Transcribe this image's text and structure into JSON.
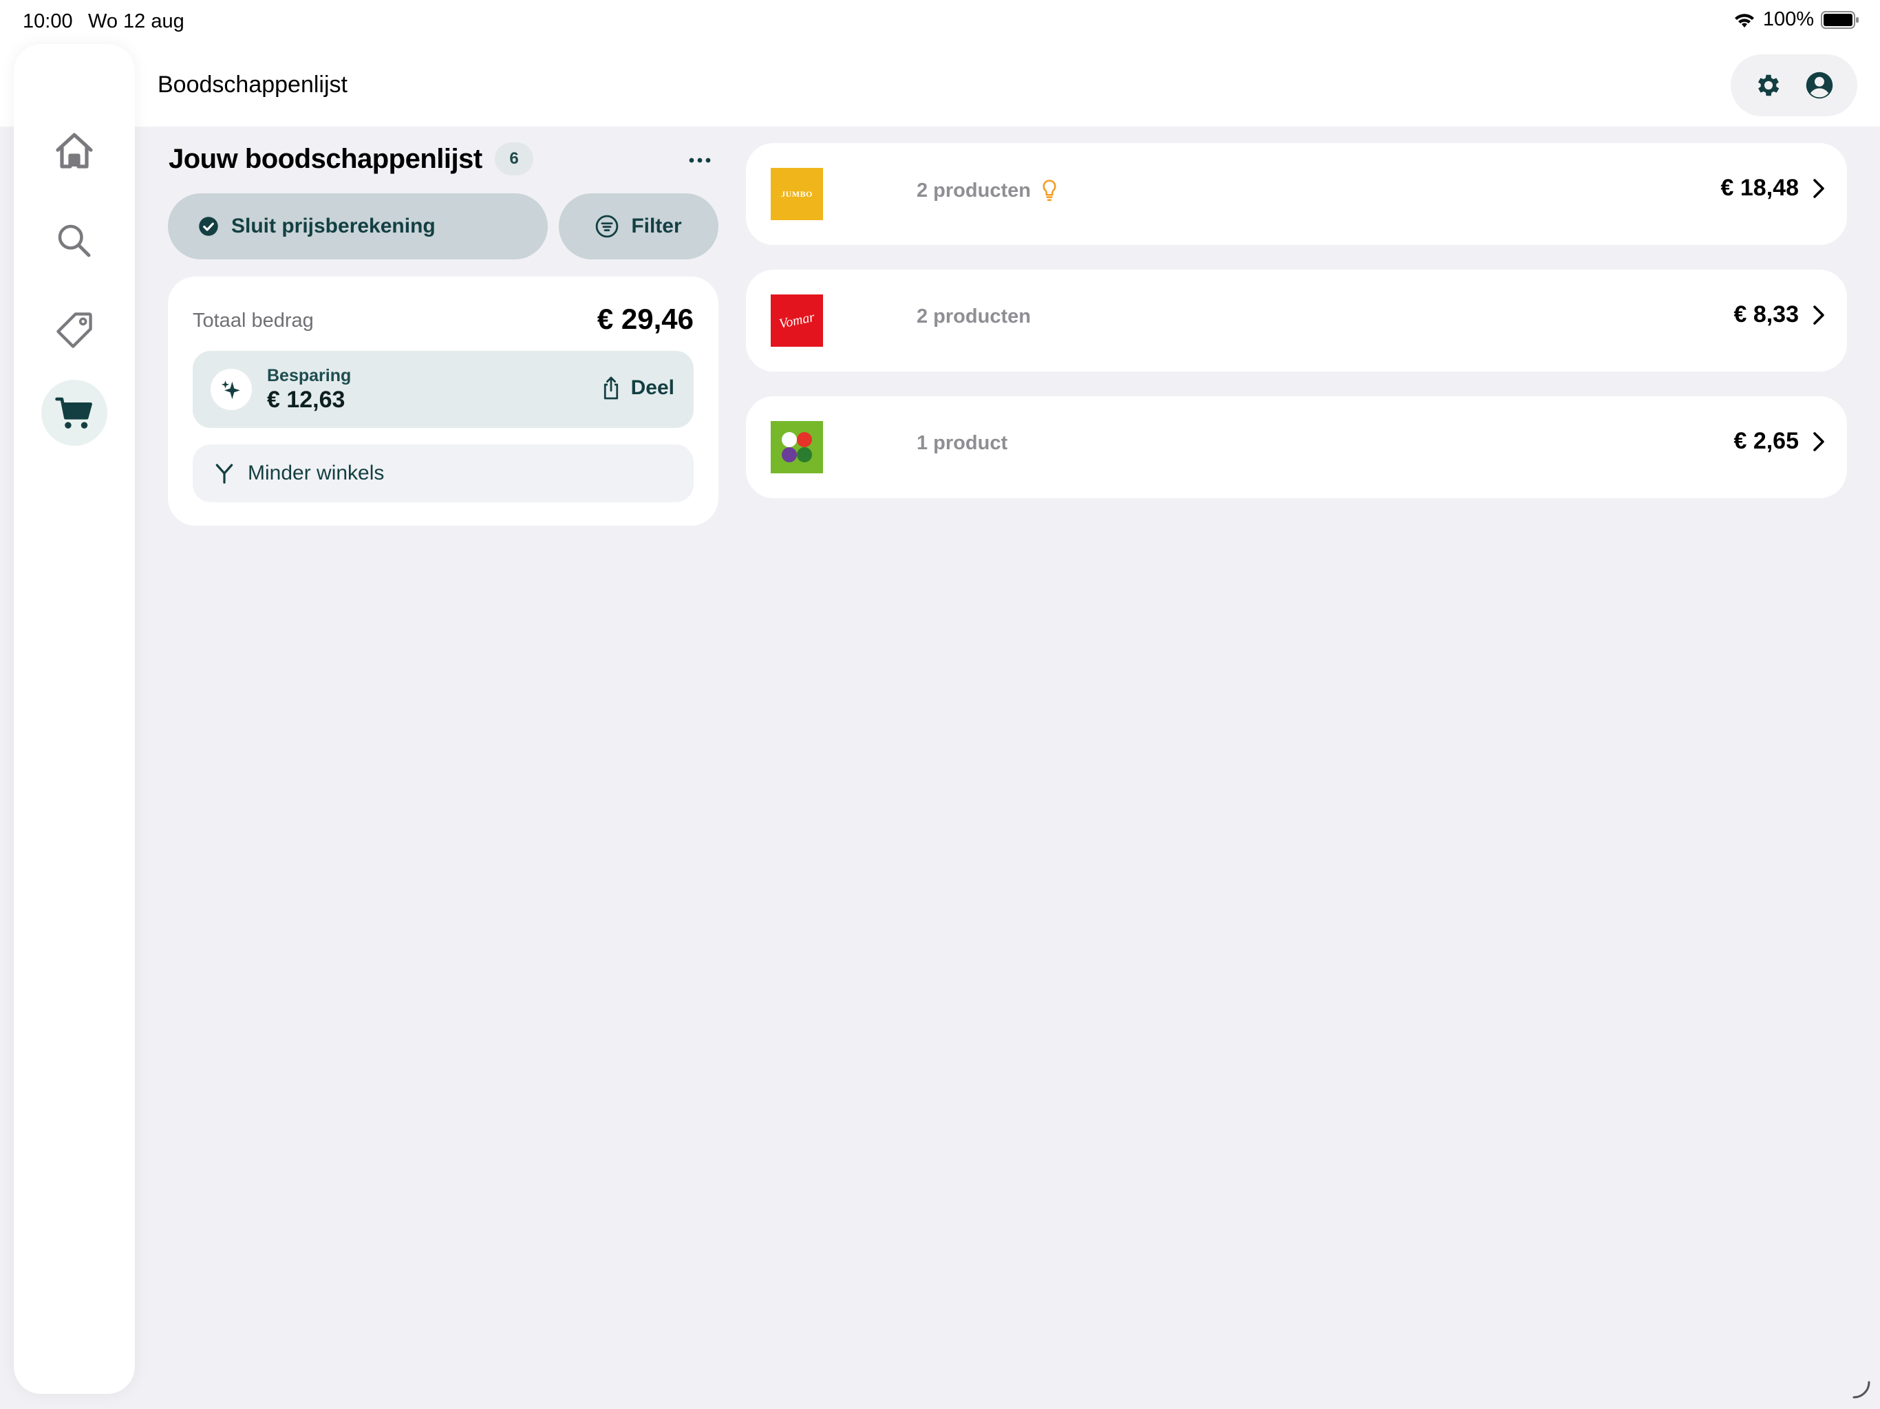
{
  "status": {
    "time": "10:00",
    "date": "Wo 12 aug",
    "battery": "100%"
  },
  "header": {
    "title": "Boodschappenlijst",
    "settings_icon": "gear-icon",
    "profile_icon": "account-circle-icon"
  },
  "sidebar": {
    "items": [
      {
        "name": "home",
        "icon": "home-icon",
        "active": false
      },
      {
        "name": "search",
        "icon": "search-icon",
        "active": false
      },
      {
        "name": "offers",
        "icon": "tag-icon",
        "active": false
      },
      {
        "name": "cart",
        "icon": "cart-icon",
        "active": true
      }
    ]
  },
  "list": {
    "title": "Jouw boodschappenlijst",
    "count": "6",
    "close_label": "Sluit prijsberekening",
    "filter_label": "Filter"
  },
  "totals": {
    "total_label": "Totaal bedrag",
    "total_amount": "€ 29,46",
    "saving_label": "Besparing",
    "saving_amount": "€ 12,63",
    "share_label": "Deel",
    "fewer_stores_label": "Minder winkels"
  },
  "stores": [
    {
      "logo": "jumbo-logo",
      "logo_text": "JUMBO",
      "products": "2 producten",
      "hint_icon": "lightbulb-icon",
      "price": "€ 18,48"
    },
    {
      "logo": "vomar-logo",
      "logo_text": "Vomar",
      "products": "2 producten",
      "price": "€ 8,33"
    },
    {
      "logo": "plus-logo",
      "products": "1 product",
      "price": "€ 2,65"
    }
  ],
  "colors": {
    "accent": "#133f42",
    "background": "#f1f1f5",
    "jumbo": "#f0b51a",
    "vomar": "#e3141d",
    "plus": "#76b82a"
  }
}
